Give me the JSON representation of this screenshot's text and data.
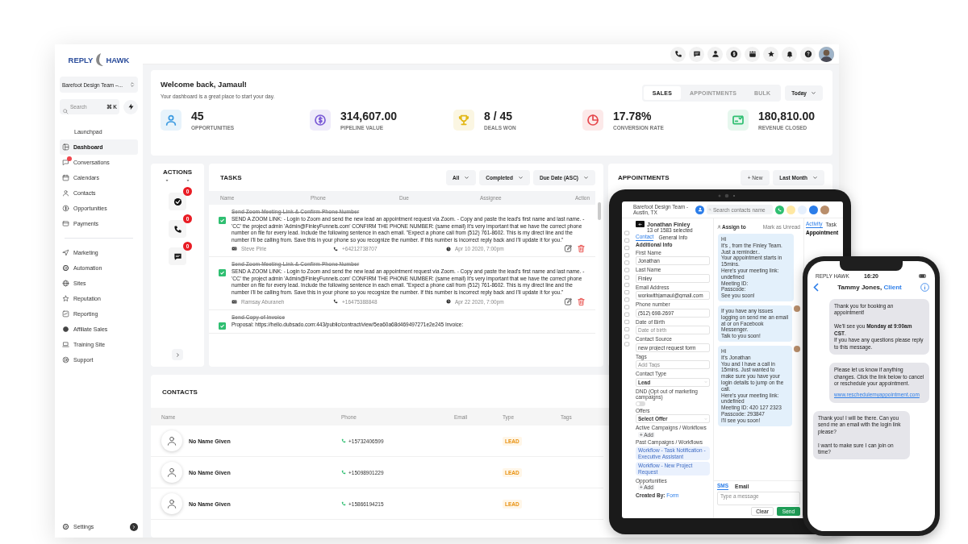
{
  "brand": {
    "left": "REPLY",
    "right": "HAWK"
  },
  "sidebar": {
    "team": "Barefoot Design Team –...",
    "search_placeholder": "Search",
    "shortcut": "⌘ K",
    "main_items": [
      {
        "label": "Launchpad",
        "selected": false,
        "notification": false
      },
      {
        "label": "Dashboard",
        "selected": true,
        "notification": false
      },
      {
        "label": "Conversations",
        "selected": false,
        "notification": true
      },
      {
        "label": "Calendars",
        "selected": false,
        "notification": false
      },
      {
        "label": "Contacts",
        "selected": false,
        "notification": false
      },
      {
        "label": "Opportunities",
        "selected": false,
        "notification": false
      },
      {
        "label": "Payments",
        "selected": false,
        "notification": false
      }
    ],
    "more_items": [
      {
        "label": "Marketing",
        "selected": false
      },
      {
        "label": "Automation",
        "selected": false
      },
      {
        "label": "Sites",
        "selected": false
      },
      {
        "label": "Reputation",
        "selected": false
      },
      {
        "label": "Reporting",
        "selected": false
      },
      {
        "label": "Affiliate Sales",
        "selected": false
      },
      {
        "label": "Training Site",
        "selected": false
      },
      {
        "label": "Support",
        "selected": false
      }
    ],
    "settings": "Settings"
  },
  "welcome": {
    "title": "Welcome back, Jamaul!",
    "subtitle": "Your dashboard is a great place to start your day.",
    "tabs": [
      {
        "label": "SALES",
        "selected": true
      },
      {
        "label": "APPOINTMENTS",
        "selected": false
      },
      {
        "label": "BULK",
        "selected": false
      }
    ],
    "range": "Today",
    "stats": [
      {
        "value": "45",
        "label": "OPPORTUNITIES",
        "color": "#3b9ae1"
      },
      {
        "value": "314,607.00",
        "label": "PIPELINE VALUE",
        "color": "#7c5cd6"
      },
      {
        "value": "8 / 45",
        "label": "DEALS WON",
        "color": "#e2b714"
      },
      {
        "value": "17.78%",
        "label": "CONVERSION RATE",
        "color": "#e5484d"
      },
      {
        "value": "180,810.00",
        "label": "REVENUE CLOSED",
        "color": "#2fbf71"
      }
    ]
  },
  "actions": {
    "title": "ACTIONS",
    "items": [
      {
        "badge": "0"
      },
      {
        "badge": "0"
      },
      {
        "badge": "0"
      }
    ]
  },
  "tasks": {
    "title": "TASKS",
    "filters": [
      "All",
      "Completed",
      "Due Date (ASC)"
    ],
    "columns": [
      "Name",
      "Phone",
      "Due",
      "Assignee",
      "Action"
    ],
    "items": [
      {
        "checked": true,
        "title": "Send Zoom Meeting Link & Confirm Phone Number",
        "description": "SEND A ZOOM LINK: - Login to Zoom and send the new lead an appointment request via Zoom. - Copy and paste the lead's first name and last name. - 'CC' the project admin 'Admin@FinleyFunnels.com' CONFIRM THE PHONE NUMBER: (same email) It's very important that we have the correct phone number on file for every lead. Include the following sentence in each email. \"Expect a phone call from (512) 761-8602. This is my direct line and the number I'll be calling from. Save this in your phone so you recognize the number. If this number is incorrect reply back and I'll update it for you.\"",
        "assignee": "Steve Pirie",
        "phone": "+64212738707",
        "due": "Apr 10 2020, 7:00pm"
      },
      {
        "checked": true,
        "title": "Send Zoom Meeting Link & Confirm Phone Number",
        "description": "SEND A ZOOM LINK: - Login to Zoom and send the new lead an appointment request via Zoom. - Copy and paste the lead's first name and last name. - 'CC' the project admin 'Admin@FinleyFunnels.com' CONFIRM THE PHONE NUMBER: (same email) It's very important that we have the correct phone number on file for every lead. Include the following sentence in each email. \"Expect a phone call from (512) 761-8602. This is my direct line and the number I'll be calling from. Save this in your phone so you recognize the number. If this number is incorrect reply back and I'll update it for you.\"",
        "assignee": "Ramsay Aburaneh",
        "phone": "+16475388848",
        "due": "Apr 22 2020, 7:00pm"
      },
      {
        "checked": true,
        "title": "Send Copy of Invoice",
        "description": "Proposal: https://hello.dubsado.com:443/public/contract/view/5ea60a68d469497271e2e245 Invoice:"
      }
    ]
  },
  "appointments": {
    "title": "APPOINTMENTS",
    "new_button": "+ New",
    "range": "Last Month"
  },
  "contacts": {
    "title": "CONTACTS",
    "columns": [
      "Name",
      "Phone",
      "Email",
      "Type",
      "Tags"
    ],
    "rows": [
      {
        "name": "No Name Given",
        "phone": "+15732406599",
        "type": "LEAD"
      },
      {
        "name": "No Name Given",
        "phone": "+15098901229",
        "type": "LEAD"
      },
      {
        "name": "No Name Given",
        "phone": "+15866194215",
        "type": "LEAD"
      }
    ]
  },
  "tablet": {
    "team": "Barefoot Design Team - Austin, TX",
    "search_placeholder": "Search contacts name",
    "contact_name": "Jonathan Finley",
    "pager": "13 of 1583 selected",
    "tabs": [
      {
        "label": "Contact",
        "selected": true
      },
      {
        "label": "General Info",
        "selected": false
      }
    ],
    "section": "Additional Info",
    "fields": [
      {
        "kind": "input",
        "label": "First Name",
        "value": "Jonathan"
      },
      {
        "kind": "input",
        "label": "Last Name",
        "value": "Finley"
      },
      {
        "kind": "input",
        "label": "Email Address",
        "value": "workwithjamaul@gmail.com"
      },
      {
        "kind": "input",
        "label": "Phone number",
        "value": "(512) 698-2697"
      },
      {
        "kind": "input",
        "label": "Date of Birth",
        "placeholder": "Date of birth"
      },
      {
        "kind": "input",
        "label": "Contact Source",
        "value": "new project request form"
      },
      {
        "kind": "input",
        "label": "Tags",
        "placeholder": "Add Tags"
      },
      {
        "kind": "select",
        "label": "Contact Type",
        "value": "Lead"
      },
      {
        "kind": "toggle",
        "label": "DND (Opt out of marketing campaigns)",
        "on": false
      },
      {
        "kind": "select",
        "label": "Offers",
        "value": "Select Offer"
      },
      {
        "kind": "add",
        "label": "Active Campaigns / Workflows",
        "button": "+ Add"
      },
      {
        "kind": "chips",
        "label": "Past Campaigns / Workflows",
        "chips": [
          "Workflow - Task Notification - Executive Assistant",
          "Workflow - New Project Request"
        ]
      },
      {
        "kind": "add",
        "label": "Opportunities",
        "button": "+ Add"
      }
    ],
    "created_label": "Created By:",
    "created_value": "Form",
    "assign": "Assign to",
    "mark_unread": "Mark as Unread",
    "right_tabs": [
      {
        "label": "Activity",
        "selected": true
      },
      {
        "label": "Task",
        "selected": false
      }
    ],
    "right_item": "Appointment",
    "messages": [
      {
        "avatar": false,
        "text": "Hi\nIt's , from the Finley Team. Just a reminder..\nYour appointment starts in 15mins.\nHere's your meeting link: undefined\nMeeting ID:\nPasscode:\nSee you soon!"
      },
      {
        "avatar": true,
        "text": "If you have any issues logging on send me an email at  or on Facebook Messenger.\nTalk to you soon!"
      },
      {
        "avatar": true,
        "text": "Hi\nIt's Jonathan\nYou and I have a call in 15mins. Just wanted to make sure you have your login details to jump on the call.\nHere's your meeting link: undefined\nMeeting ID: 420 127 2323\nPasscode: 293847\nI'll see you soon!"
      }
    ],
    "compose_tabs": [
      {
        "label": "SMS",
        "selected": true
      },
      {
        "label": "Email",
        "selected": false
      }
    ],
    "compose_placeholder": "Type a message",
    "clear": "Clear",
    "send": "Send"
  },
  "phone": {
    "carrier": "REPLY HAWK",
    "time": "16:20",
    "name": "Tammy Jones,",
    "role": "Client",
    "messages": [
      {
        "kind": "outgoing",
        "text": "Thank you for booking an appointment!\n\nWe'll see you **Monday at 9:00am CST**.\nIf you have any questions please reply to this message."
      },
      {
        "kind": "outgoing",
        "text": "Please let us know if anything changes. Click the link below to cancel or reschedule your appointment.",
        "link": "www.reschedulemyappointment.com"
      },
      {
        "kind": "incoming",
        "text": "Thank you! I will be there. Can you send me an email with the login link please?\n\nI want to make sure I can join on time?"
      }
    ]
  }
}
